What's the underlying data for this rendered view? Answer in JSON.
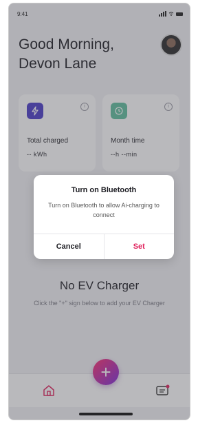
{
  "status": {
    "time": "9:41"
  },
  "header": {
    "greeting": "Good Morning,",
    "user_name": "Devon Lane"
  },
  "cards": [
    {
      "label": "Total charged",
      "value": "-- kWh",
      "icon": "bolt-icon",
      "color": "#4b3cc9"
    },
    {
      "label": "Month time",
      "value": "--h --min",
      "icon": "history-icon",
      "color": "#5fbf9e"
    }
  ],
  "empty_state": {
    "title": "No EV Charger",
    "subtitle": "Click the \"+\" sign below to add your EV Charger"
  },
  "dialog": {
    "title": "Turn on Bluetooth",
    "message": "Turn on Bluetooth to allow Ai-charging to connect",
    "cancel_label": "Cancel",
    "set_label": "Set"
  },
  "tabbar": {
    "fab_label": "+"
  },
  "colors": {
    "accent": "#e0245e",
    "fab_start": "#ff2e6e",
    "fab_end": "#7c2bdc"
  }
}
